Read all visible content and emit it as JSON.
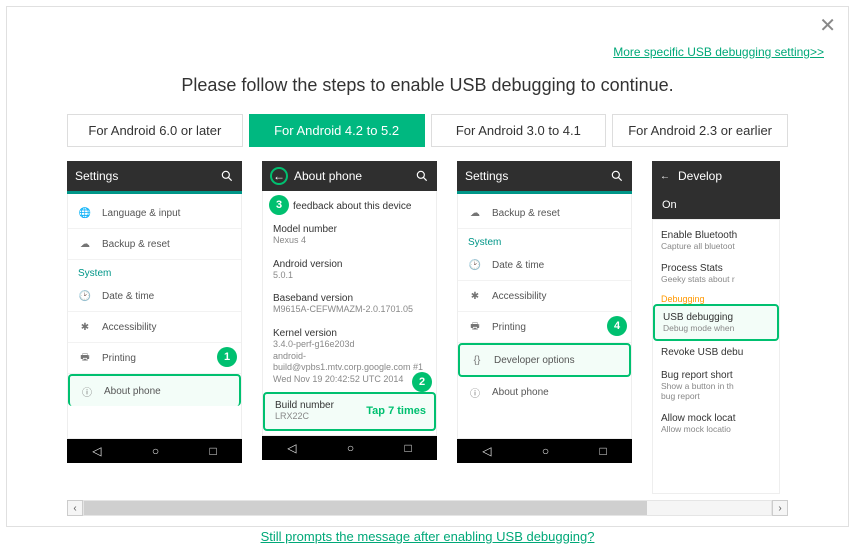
{
  "links": {
    "more": "More specific USB debugging setting>>",
    "still": "Still prompts the message after enabling USB debugging?"
  },
  "title": "Please follow the steps to enable USB debugging to continue.",
  "tabs": [
    {
      "label": "For Android 6.0 or later"
    },
    {
      "label": "For Android 4.2 to 5.2"
    },
    {
      "label": "For Android 3.0 to 4.1"
    },
    {
      "label": "For Android 2.3 or earlier"
    }
  ],
  "screens": {
    "s1": {
      "title": "Settings",
      "rows": {
        "lang": "Language & input",
        "backup": "Backup & reset",
        "system": "System",
        "date": "Date & time",
        "acc": "Accessibility",
        "print": "Printing",
        "about": "About phone"
      },
      "badge": "1"
    },
    "s2": {
      "title": "About phone",
      "feedback": "feedback about this device",
      "model_k": "Model number",
      "model_v": "Nexus 4",
      "and_k": "Android version",
      "and_v": "5.0.1",
      "base_k": "Baseband version",
      "base_v": "M9615A-CEFWMAZM-2.0.1701.05",
      "kern_k": "Kernel version",
      "kern_v": "3.4.0-perf-g16e203d\nandroid-build@vpbs1.mtv.corp.google.com #1\nWed Nov 19 20:42:52 UTC 2014",
      "build_k": "Build number",
      "build_v": "LRX22C",
      "tap": "Tap 7 times",
      "badge_top": "3",
      "badge_mid": "2"
    },
    "s3": {
      "title": "Settings",
      "rows": {
        "backup": "Backup & reset",
        "system": "System",
        "date": "Date & time",
        "acc": "Accessibility",
        "print": "Printing",
        "dev": "Developer options",
        "about": "About phone"
      },
      "badge": "4"
    },
    "s4": {
      "title": "Develop",
      "on": "On",
      "bt_k": "Enable Bluetooth",
      "bt_v": "Capture all bluetoot",
      "ps_k": "Process Stats",
      "ps_v": "Geeky stats about r",
      "dbg": "Debugging",
      "usb_k": "USB debugging",
      "usb_v": "Debug mode when",
      "rev_k": "Revoke USB debu",
      "bug_k": "Bug report short",
      "bug_v": "Show a button in th\nbug report",
      "mock_k": "Allow mock locat",
      "mock_v": "Allow mock locatio"
    }
  }
}
